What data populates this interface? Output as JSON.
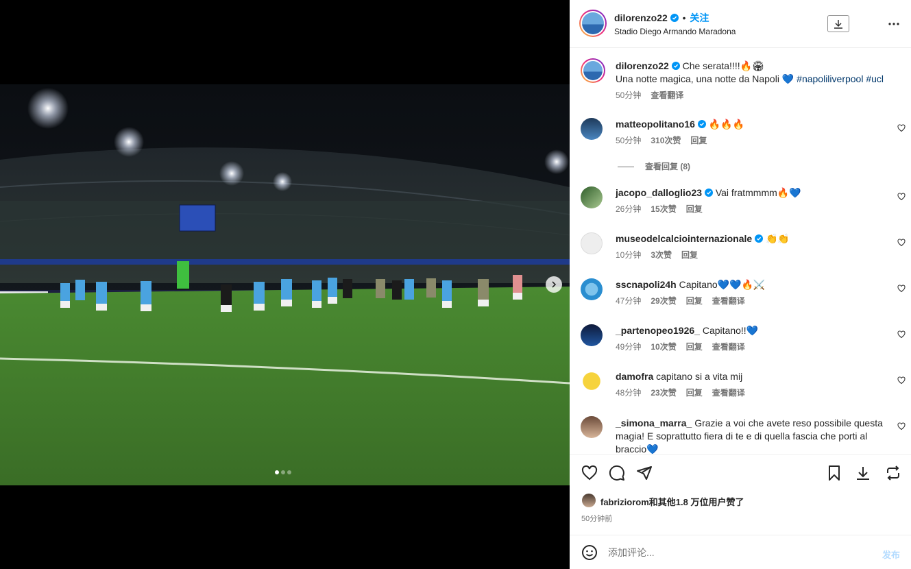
{
  "post": {
    "username": "dilorenzo22",
    "follow_label": "关注",
    "separator": "•",
    "location": "Stadio Diego Armando Maradona"
  },
  "caption": {
    "username": "dilorenzo22",
    "text": "Che serata!!!!🔥🏟",
    "line2": "Una notte magica, una notte da Napoli 💙 ",
    "hashtags": "#napoliliverpool #ucl",
    "time": "50分钟",
    "translate": "查看翻译"
  },
  "comments": [
    {
      "username": "matteopolitano16",
      "verified": true,
      "text": "🔥🔥🔥",
      "time": "50分钟",
      "likes": "310次赞",
      "reply": "回复",
      "translate": ""
    },
    {
      "username": "jacopo_dalloglio23",
      "verified": true,
      "text": "Vai fratmmmm🔥💙",
      "time": "26分钟",
      "likes": "15次赞",
      "reply": "回复",
      "translate": ""
    },
    {
      "username": "museodelcalciointernazionale",
      "verified": true,
      "text": "👏👏",
      "time": "10分钟",
      "likes": "3次赞",
      "reply": "回复",
      "translate": ""
    },
    {
      "username": "sscnapoli24h",
      "verified": false,
      "text": "Capitano💙💙🔥⚔️",
      "time": "47分钟",
      "likes": "29次赞",
      "reply": "回复",
      "translate": "查看翻译"
    },
    {
      "username": "_partenopeo1926_",
      "verified": false,
      "text": "Capitano!!💙",
      "time": "49分钟",
      "likes": "10次赞",
      "reply": "回复",
      "translate": "查看翻译"
    },
    {
      "username": "damofra",
      "verified": false,
      "text": "capitano si a vita mij",
      "time": "48分钟",
      "likes": "23次赞",
      "reply": "回复",
      "translate": "查看翻译"
    },
    {
      "username": "_simona_marra_",
      "verified": false,
      "text": "Grazie a voi che avete reso possibile questa magia! E soprattutto fiera di te e di quella fascia che porti al braccio💙",
      "time": "",
      "likes": "",
      "reply": "",
      "translate": ""
    }
  ],
  "view_replies": "查看回复 (8)",
  "likes_line": {
    "user": "fabriziorom",
    "rest": "和其他1.8 万位用户赞了"
  },
  "post_time": "50分钟前",
  "add_comment": {
    "placeholder": "添加评论...",
    "post_label": "发布"
  },
  "colors": {
    "accent": "#0095f6",
    "verified": "#0095f6",
    "muted": "#737373",
    "pitch": "#3f7a2a",
    "kit": "#4aa3e0"
  },
  "icons": [
    "heart-icon",
    "comment-icon",
    "share-icon",
    "bookmark-icon",
    "download-icon",
    "repost-icon",
    "more-icon",
    "emoji-icon",
    "chevron-right-icon"
  ]
}
